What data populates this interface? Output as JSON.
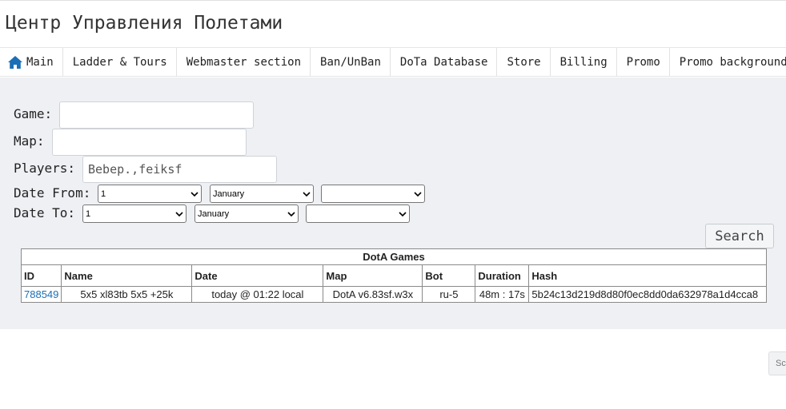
{
  "header": {
    "title": "Центр Управления Полетами"
  },
  "nav": {
    "items": [
      {
        "label": "Main",
        "icon": "home-icon"
      },
      {
        "label": "Ladder & Tours"
      },
      {
        "label": "Webmaster section"
      },
      {
        "label": "Ban/UnBan"
      },
      {
        "label": "DoTa Database"
      },
      {
        "label": "Store"
      },
      {
        "label": "Billing"
      },
      {
        "label": "Promo"
      },
      {
        "label": "Promo background"
      }
    ],
    "accent": "#1a6fb5"
  },
  "filters": {
    "game_label": "Game:",
    "game_value": "",
    "map_label": "Map:",
    "map_value": "",
    "players_label": "Players:",
    "players_value": "Bebep.,feiksf",
    "date_from_label": "Date From:",
    "date_from": {
      "day": "1",
      "month": "January",
      "year": ""
    },
    "date_to_label": "Date To:",
    "date_to": {
      "day": "1",
      "month": "January",
      "year": ""
    },
    "search_label": "Search"
  },
  "table": {
    "caption": "DotA Games",
    "columns": [
      "ID",
      "Name",
      "Date",
      "Map",
      "Bot",
      "Duration",
      "Hash"
    ],
    "rows": [
      {
        "id": "788549",
        "name": "5x5 xl83tb 5x5 +25k",
        "date": "today @ 01:22 local",
        "map": "DotA v6.83sf.w3x",
        "bot": "ru-5",
        "duration": "48m : 17s",
        "hash": "5b24c13d219d8d80f0ec8dd0da632978a1d4cca8"
      }
    ]
  },
  "corner": {
    "label": "Sc"
  }
}
